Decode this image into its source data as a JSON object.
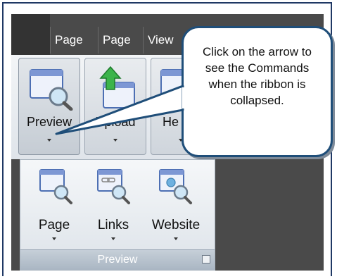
{
  "tabs": [
    "Page",
    "Page",
    "View"
  ],
  "ribbon": {
    "big_buttons": [
      {
        "label": "Preview",
        "icon": "preview-icon"
      },
      {
        "label": "Upload",
        "icon": "upload-icon"
      },
      {
        "label": "He",
        "icon": "help-icon"
      }
    ],
    "group": {
      "buttons": [
        {
          "label": "Page",
          "icon": "page-preview-icon"
        },
        {
          "label": "Links",
          "icon": "links-preview-icon"
        },
        {
          "label": "Website",
          "icon": "website-preview-icon"
        }
      ],
      "title": "Preview"
    }
  },
  "callout": {
    "text": "Click on the arrow to see the Commands when the ribbon is collapsed."
  },
  "colors": {
    "frame": "#1f3864",
    "dark_bg": "#4a4a4a",
    "callout_border": "#1f4e79",
    "arrow": "#1f4e79"
  }
}
